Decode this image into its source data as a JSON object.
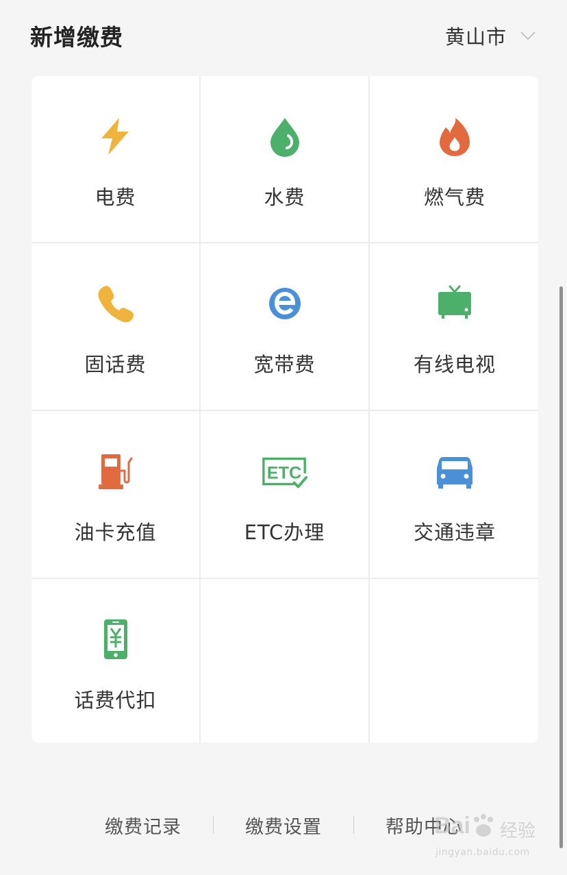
{
  "header": {
    "title": "新增缴费",
    "city": "黄山市"
  },
  "services": [
    {
      "label": "电费",
      "icon": "lightning-icon",
      "color": "#F0B43C"
    },
    {
      "label": "水费",
      "icon": "water-drop-icon",
      "color": "#4CAF6A"
    },
    {
      "label": "燃气费",
      "icon": "flame-icon",
      "color": "#E3693F"
    },
    {
      "label": "固话费",
      "icon": "phone-icon",
      "color": "#F0B43C"
    },
    {
      "label": "宽带费",
      "icon": "broadband-e-icon",
      "color": "#4A90D9"
    },
    {
      "label": "有线电视",
      "icon": "tv-icon",
      "color": "#4CAF6A"
    },
    {
      "label": "油卡充值",
      "icon": "fuel-pump-icon",
      "color": "#E3693F"
    },
    {
      "label": "ETC办理",
      "icon": "etc-icon",
      "color": "#4CAF6A"
    },
    {
      "label": "交通违章",
      "icon": "car-icon",
      "color": "#4A90D9"
    },
    {
      "label": "话费代扣",
      "icon": "mobile-yuan-icon",
      "color": "#4CAF6A"
    }
  ],
  "footer": {
    "links": [
      "缴费记录",
      "缴费设置",
      "帮助中心"
    ]
  },
  "watermark": {
    "brand": "Bai",
    "brand2": "du",
    "cn": "经验",
    "url": "jingyan.baidu.com"
  }
}
